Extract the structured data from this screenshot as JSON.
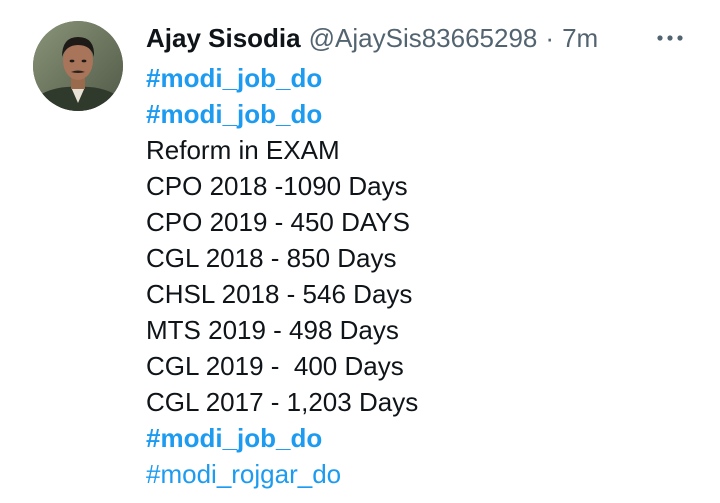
{
  "tweet": {
    "author_name": "Ajay Sisodia",
    "handle": "@AjaySis83665298",
    "separator": "·",
    "time": "7m",
    "more_icon": "more-horizontal-icon",
    "lines": [
      {
        "text": "#modi_job_do",
        "kind": "hashtag-bold"
      },
      {
        "text": "#modi_job_do",
        "kind": "hashtag-bold"
      },
      {
        "text": "Reform in EXAM",
        "kind": "text"
      },
      {
        "text": "CPO 2018 -1090 Days",
        "kind": "text"
      },
      {
        "text": "CPO 2019 - 450 DAYS",
        "kind": "text"
      },
      {
        "text": "CGL 2018 - 850 Days",
        "kind": "text"
      },
      {
        "text": "CHSL 2018 - 546 Days",
        "kind": "text"
      },
      {
        "text": "MTS 2019 - 498 Days",
        "kind": "text"
      },
      {
        "text": "CGL 2019 -  400 Days",
        "kind": "text"
      },
      {
        "text": "CGL 2017 - 1,203 Days",
        "kind": "text"
      },
      {
        "text": "#modi_job_do",
        "kind": "hashtag-bold"
      },
      {
        "text": "#modi_rojgar_do",
        "kind": "hashtag"
      }
    ]
  },
  "colors": {
    "hashtag": "#1d9bf0",
    "secondary_text": "#536471",
    "primary_text": "#0f1419"
  }
}
